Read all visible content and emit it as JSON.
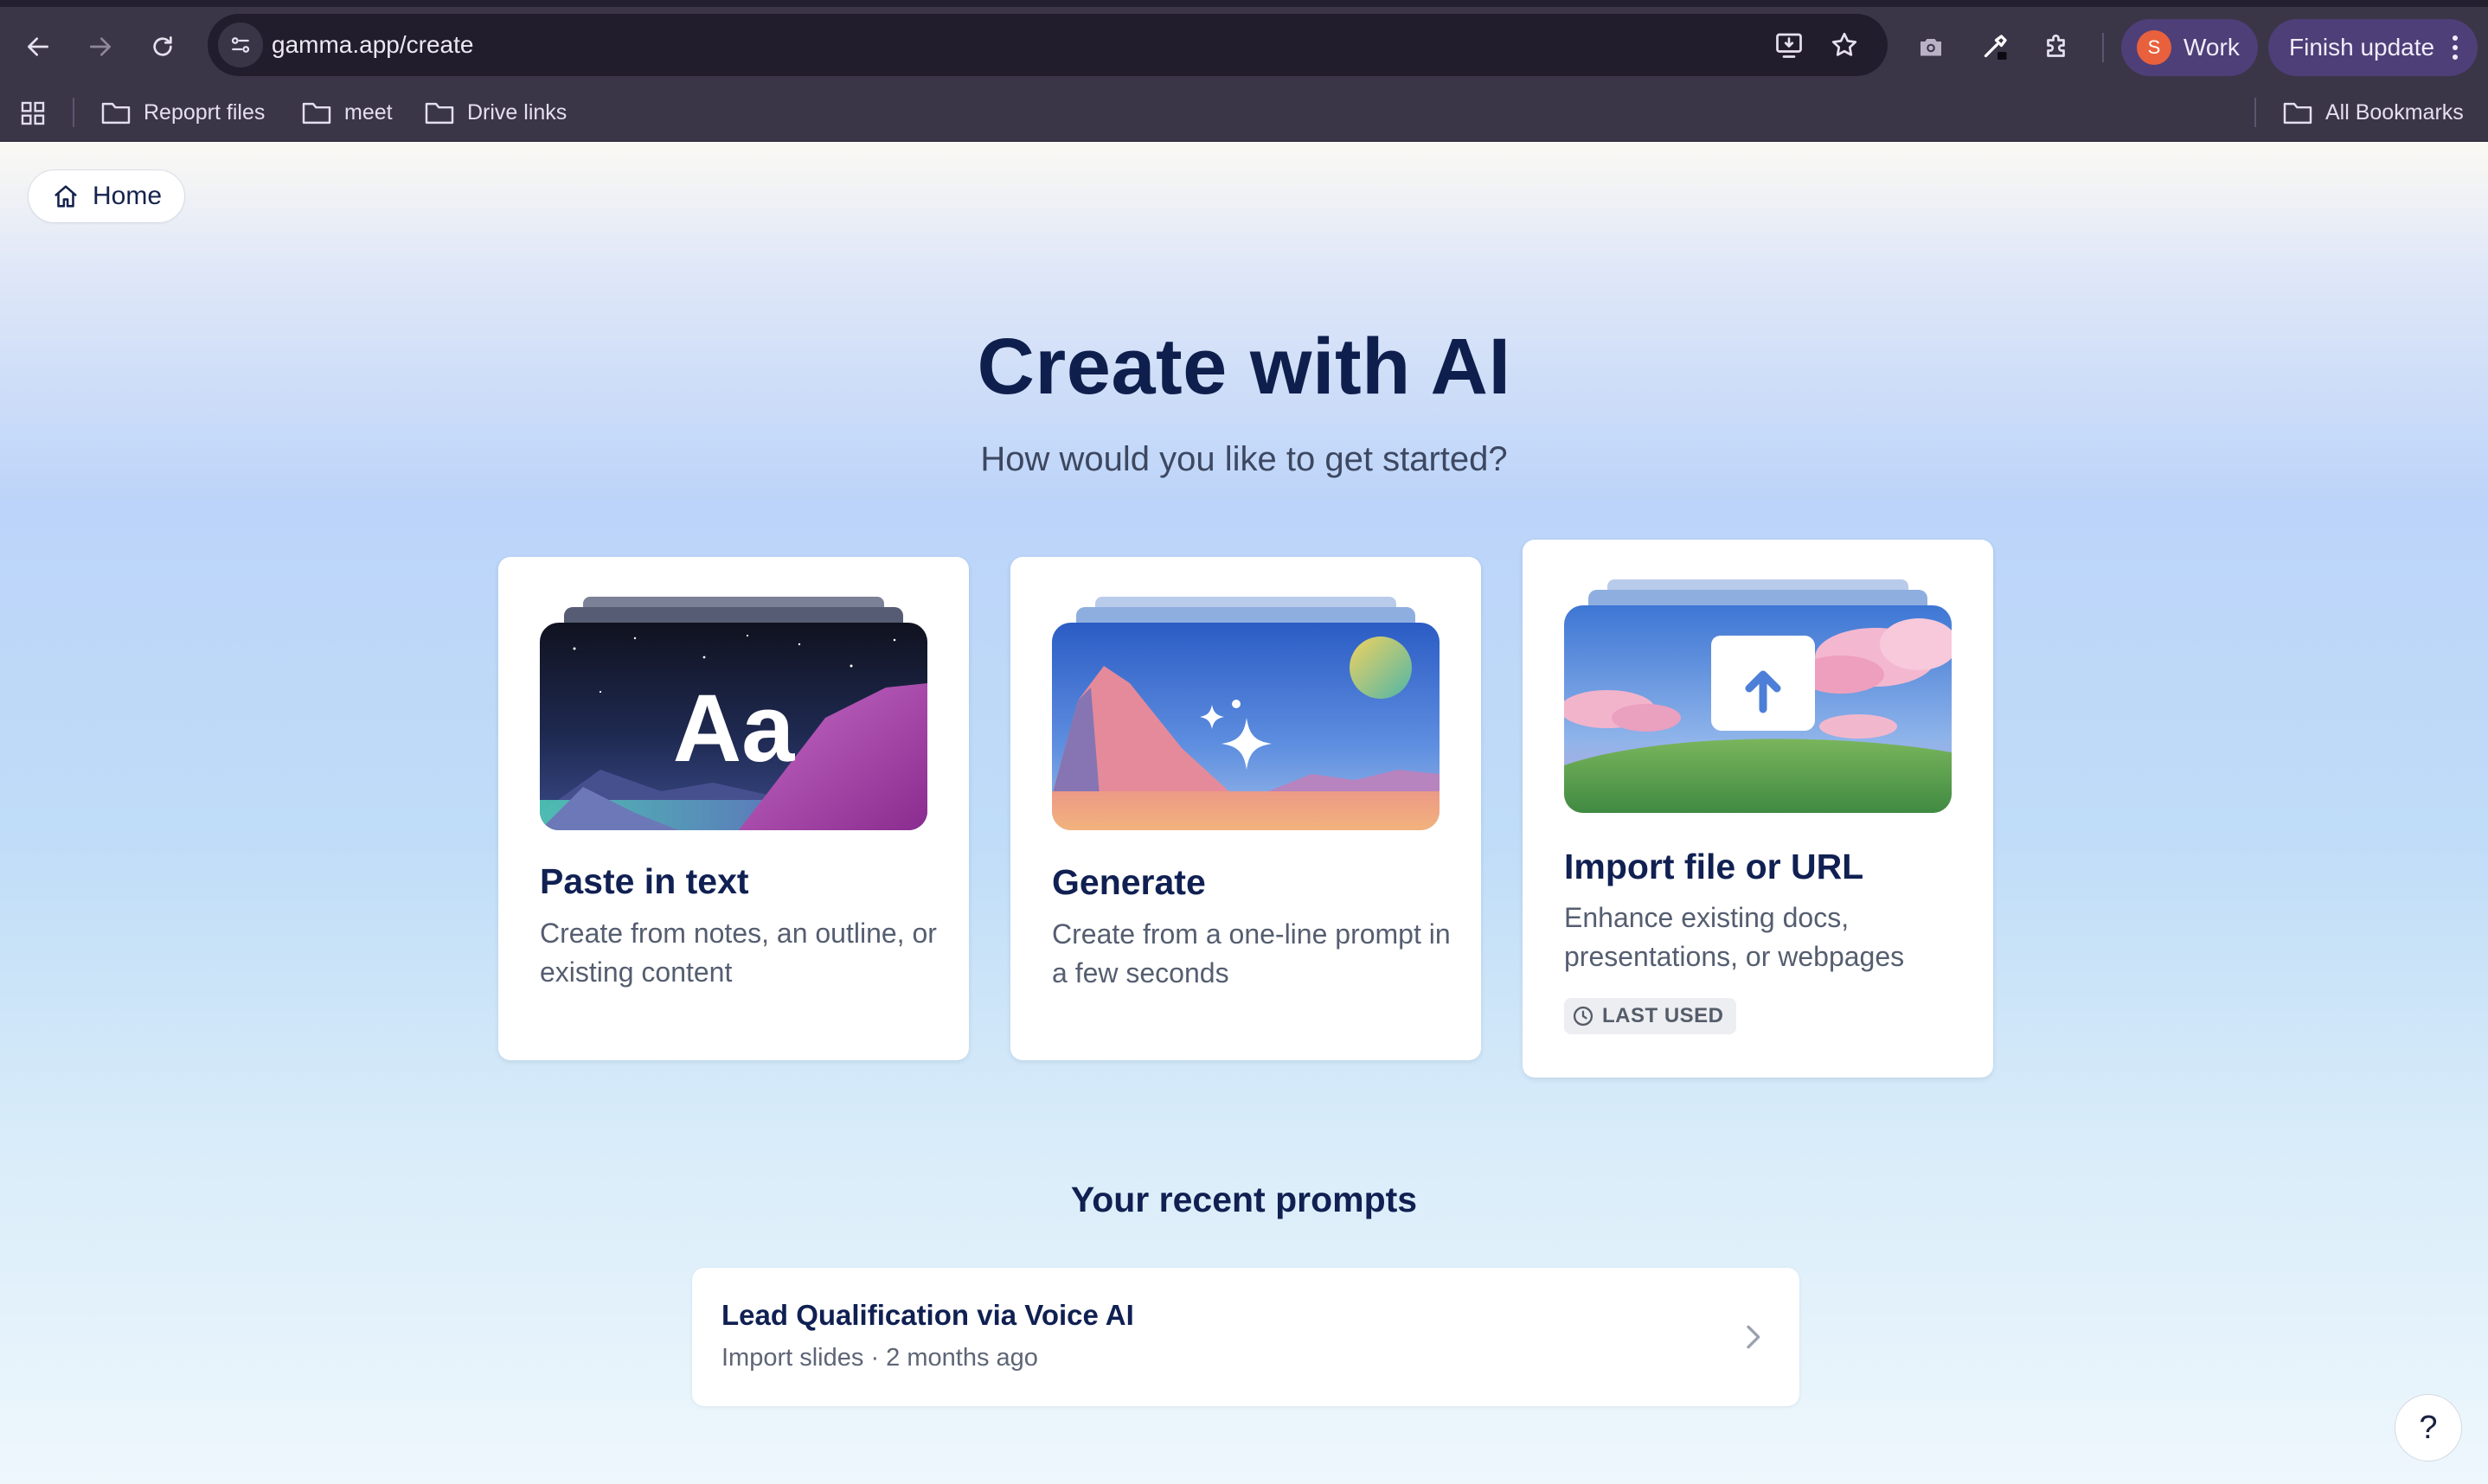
{
  "browser": {
    "url": "gamma.app/create",
    "profile": {
      "initial": "S",
      "label": "Work"
    },
    "update_label": "Finish update",
    "bookmarks": [
      "Repoprt files",
      "meet",
      "Drive links"
    ],
    "all_bookmarks_label": "All Bookmarks"
  },
  "page": {
    "home_label": "Home",
    "title": "Create with AI",
    "subtitle": "How would you like to get started?",
    "cards": [
      {
        "title": "Paste in text",
        "description": "Create from notes, an outline, or existing content",
        "art_text": "Aa"
      },
      {
        "title": "Generate",
        "description": "Create from a one-line prompt in a few seconds"
      },
      {
        "title": "Import file or URL",
        "description": "Enhance existing docs, presentations, or webpages",
        "badge": "LAST USED"
      }
    ],
    "recent_title": "Your recent prompts",
    "recent": [
      {
        "name": "Lead Qualification via Voice AI",
        "meta": "Import slides · 2 months ago"
      }
    ],
    "help_label": "?"
  },
  "colors": {
    "browser_bg": "#3b3548",
    "omnibox_bg": "#221d2c",
    "pill_bg": "#4e3f78",
    "heading": "#0f1f4d",
    "avatar": "#e8613c"
  }
}
